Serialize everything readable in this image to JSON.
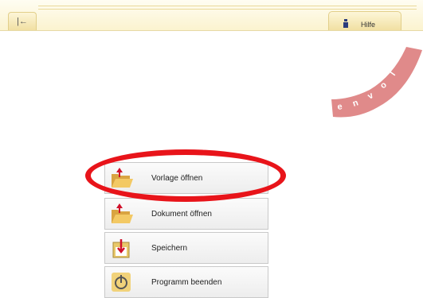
{
  "toolbar": {
    "back_glyph": "|←",
    "help_label": "Hilfe",
    "help_icon": "info-icon"
  },
  "logo": {
    "text": "envol",
    "color": "#e08a8a"
  },
  "menu": {
    "items": [
      {
        "label": "Vorlage öffnen",
        "icon": "open-folder-icon"
      },
      {
        "label": "Dokument öffnen",
        "icon": "open-folder-icon"
      },
      {
        "label": "Speichern",
        "icon": "save-icon"
      },
      {
        "label": "Programm beenden",
        "icon": "power-icon"
      }
    ]
  },
  "highlight_color": "#e8141a"
}
